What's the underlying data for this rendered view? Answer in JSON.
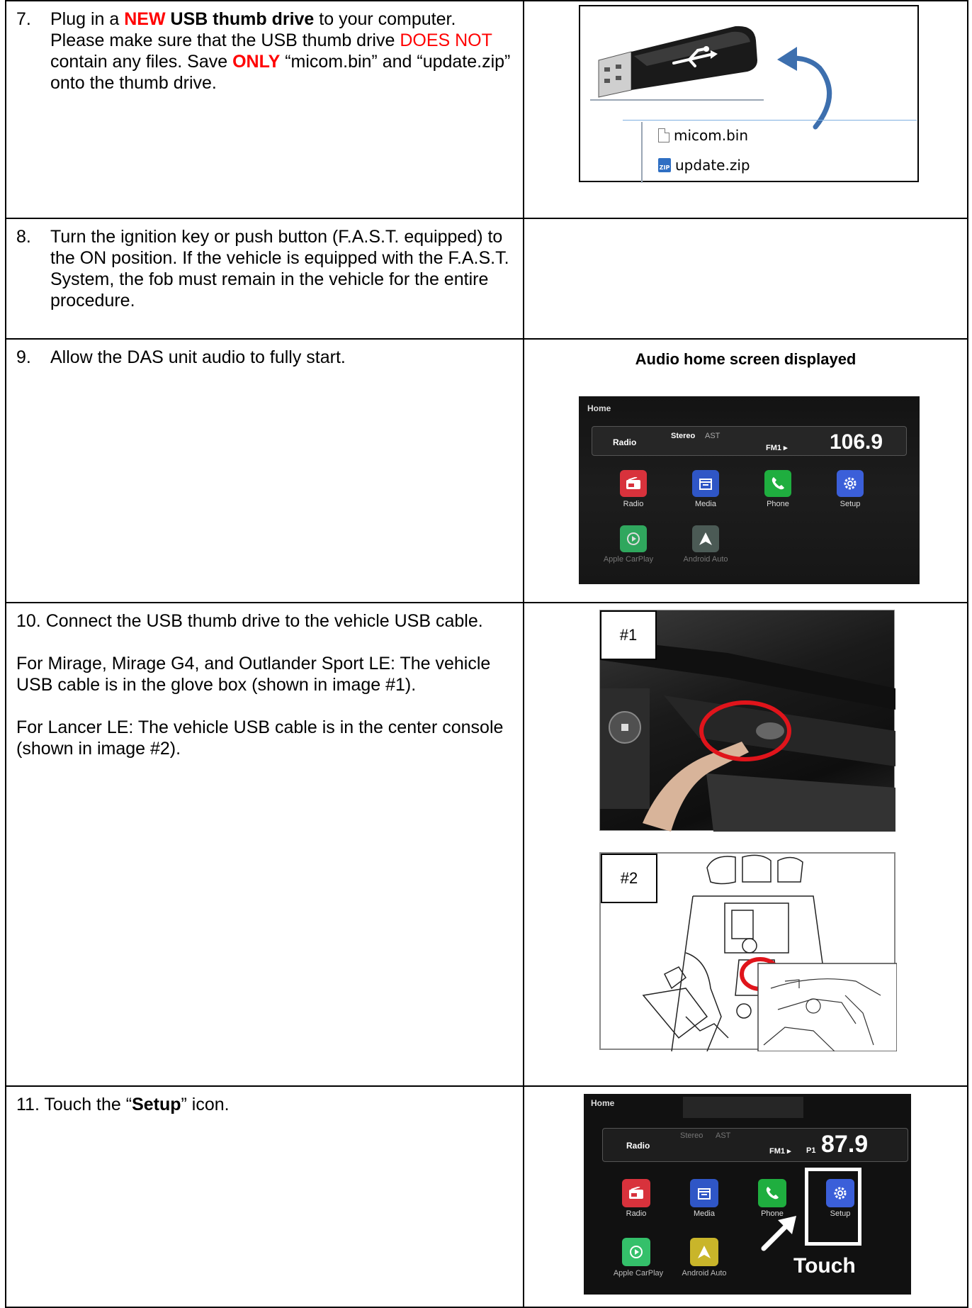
{
  "steps": {
    "s7": {
      "num": "7.",
      "t1": "Plug in a ",
      "t2": "NEW",
      "t3": " USB thumb drive",
      "t4": " to your computer. Please make sure that the USB thumb drive ",
      "t5": "DOES NOT",
      "t6": " contain any files. Save ",
      "t7": "ONLY",
      "t8": " “micom.bin” and “update.zip” onto the thumb drive."
    },
    "s8": {
      "num": "8.",
      "text": "Turn the ignition key or push button (F.A.S.T. equipped) to the ON position. If the vehicle is equipped with the F.A.S.T. System, the fob must remain in the vehicle for the entire procedure."
    },
    "s9": {
      "num": "9.",
      "text": "Allow the DAS unit audio to fully start."
    },
    "s10": {
      "p1": "10. Connect the USB thumb drive to the vehicle USB cable.",
      "p2": "For Mirage, Mirage G4, and Outlander Sport LE: The vehicle USB cable is in the glove box (shown in image #1).",
      "p3": "For Lancer LE: The vehicle USB cable is in the center console (shown in image #2)."
    },
    "s11": {
      "t1": "11. Touch the “",
      "t2": "Setup",
      "t3": "” icon."
    }
  },
  "images": {
    "files": [
      "micom.bin",
      "update.zip"
    ],
    "zip_badge": "ZIP",
    "caption9": "Audio home screen displayed",
    "screen9": {
      "home": "Home",
      "radio": "Radio",
      "stereo": "Stereo",
      "ast": "AST",
      "fm": "FM1 ▸",
      "freq": "106.9",
      "apps": [
        "Radio",
        "Media",
        "Phone",
        "Setup",
        "Apple CarPlay",
        "Android Auto"
      ]
    },
    "tag1": "#1",
    "tag2": "#2",
    "screen11": {
      "home": "Home",
      "radio": "Radio",
      "stereo": "Stereo",
      "ast": "AST",
      "fm": "FM1 ▸",
      "preset": "P1",
      "freq": "87.9",
      "apps": [
        "Radio",
        "Media",
        "Phone",
        "Setup",
        "Apple CarPlay",
        "Android Auto"
      ],
      "touch": "Touch"
    }
  },
  "colors": {
    "emphasis_red": "#ff0000",
    "radio_app": "#d8323c",
    "media_app": "#2f56c6",
    "phone_app": "#1fae3f",
    "setup_app": "#3b5fd9",
    "carplay_app": "#34c06a",
    "androidauto_app": "#c9b52a"
  }
}
